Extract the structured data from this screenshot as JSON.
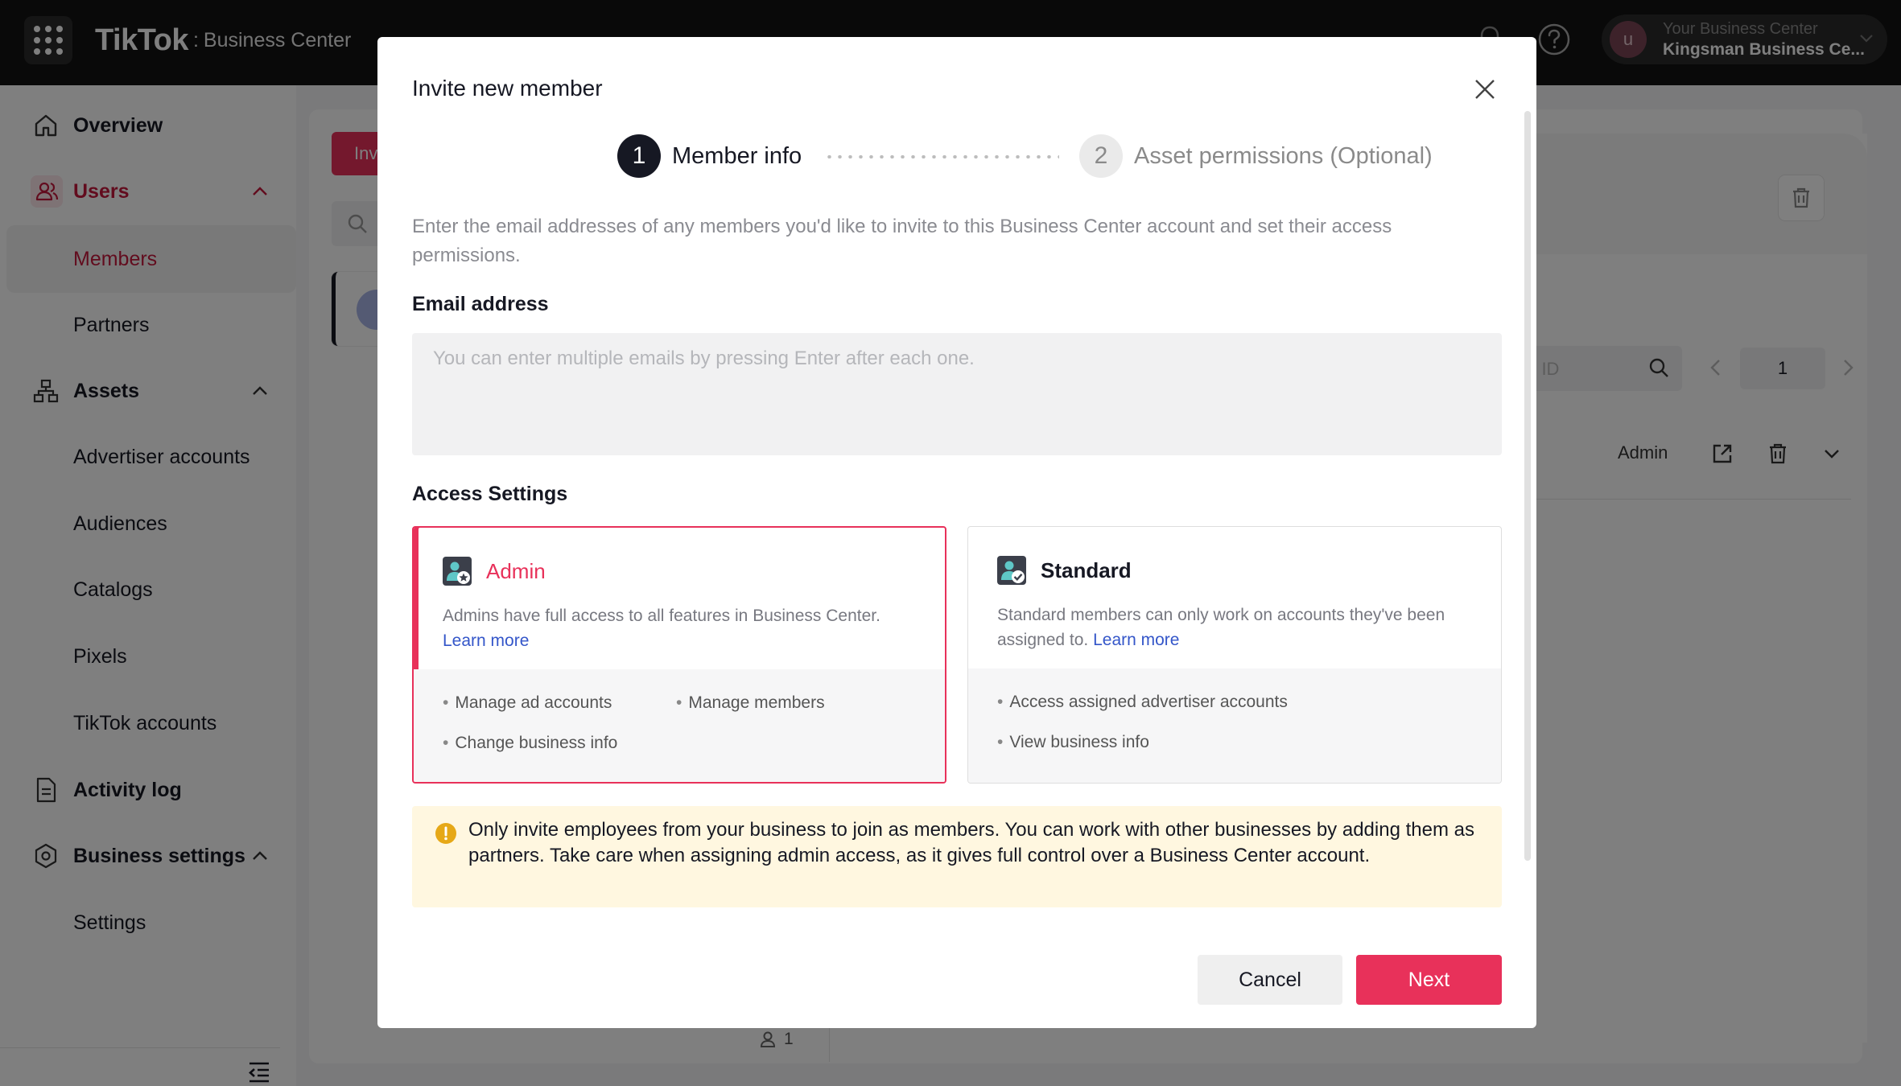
{
  "topbar": {
    "brand_logo": "TikTok",
    "brand_separator": ":",
    "brand_sub": "Business Center",
    "account_avatar": "u",
    "account_label": "Your Business Center",
    "account_name": "Kingsman Business Ce...",
    "icons": [
      "apps-grid-icon",
      "bell-icon",
      "help-icon",
      "chevron-down-icon"
    ]
  },
  "sidebar": {
    "overview": "Overview",
    "users": "Users",
    "members": "Members",
    "partners": "Partners",
    "assets": "Assets",
    "advertiser_accounts": "Advertiser accounts",
    "audiences": "Audiences",
    "catalogs": "Catalogs",
    "pixels": "Pixels",
    "tiktok_accounts": "TikTok accounts",
    "activity_log": "Activity log",
    "business_settings": "Business settings",
    "settings": "Settings",
    "colors": {
      "active": "#c4183c",
      "active_bg": "#fde6eb"
    }
  },
  "background": {
    "invite_button_partial": "Inv",
    "id_search_partial": "r ID",
    "page_number": "1",
    "row_role": "Admin",
    "member_count": "1"
  },
  "modal": {
    "title": "Invite new member",
    "steps": [
      {
        "number": "1",
        "label": "Member info"
      },
      {
        "number": "2",
        "label": "Asset permissions (Optional)"
      }
    ],
    "description": "Enter the email addresses of any members you'd like to invite to this Business Center account and set their access permissions.",
    "email": {
      "label": "Email address",
      "placeholder": "You can enter multiple emails by pressing Enter after each one.",
      "value": ""
    },
    "access_label": "Access Settings",
    "admin": {
      "name": "Admin",
      "description": "Admins have full access to all features in Business Center.",
      "learn_more": "Learn more",
      "perms": [
        "Manage ad accounts",
        "Manage members",
        "Change business info"
      ]
    },
    "standard": {
      "name": "Standard",
      "description": "Standard members can only work on accounts they've been assigned to.",
      "learn_more": "Learn more",
      "perms": [
        "Access assigned advertiser accounts",
        "View business info"
      ]
    },
    "notice": "Only invite employees from your business to join as members. You can work with other businesses by adding them as partners. Take care when assigning admin access, as it gives full control over a Business Center account.",
    "cancel_label": "Cancel",
    "next_label": "Next",
    "colors": {
      "primary": "#e8315a",
      "link": "#3456c9",
      "notice_bg": "#fff7e0",
      "warning": "#e6a817"
    }
  }
}
